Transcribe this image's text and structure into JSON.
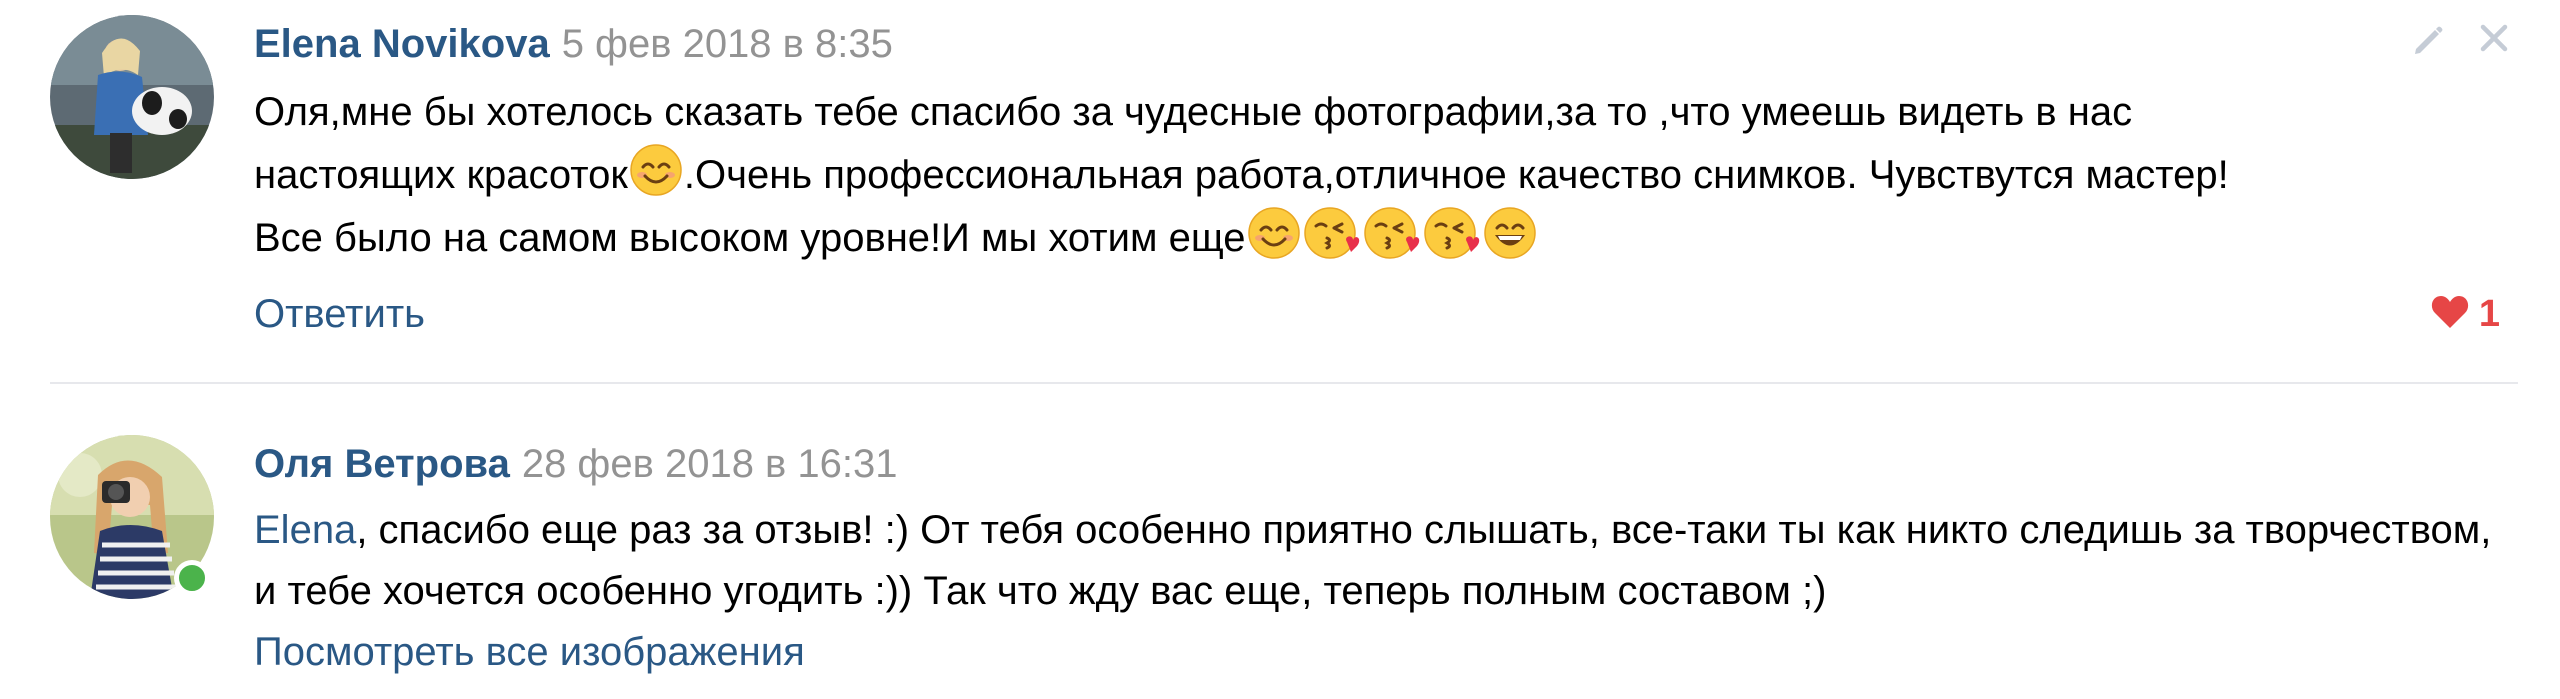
{
  "comments": [
    {
      "author": "Elena Novikova",
      "date": "5 фев 2018 в 8:35",
      "text_line_1": "Оля,мне бы хотелось сказать тебе спасибо за чудесные фотографии,за то ,что умеешь видеть в нас",
      "text_line_2a": "настоящих красоток",
      "text_line_2b": ".Очень профессиональная работа,отличное качество снимков. Чувствутся мастер!",
      "text_line_3": "Все было на самом высоком уровне!И мы хотим еще",
      "reply_label": "Ответить",
      "likes": "1",
      "emojis": [
        "smiling-face-emoji",
        "face-blowing-kiss-emoji",
        "grinning-face-emoji"
      ]
    },
    {
      "author": "Оля Ветрова",
      "date": "28 фев 2018 в 16:31",
      "mention": "Elena",
      "text_rest": ", спасибо еще раз за отзыв! :) От тебя особенно приятно слышать, все-таки ты как никто следишь за творчеством, и тебе хочется особенно угодить :)) Так что жду вас еще, теперь полным составом ;)",
      "view_all_images_label": "Посмотреть все изображения",
      "online": true
    }
  ],
  "icons": {
    "edit": "pencil-icon",
    "delete": "close-icon",
    "like": "heart-icon"
  },
  "colors": {
    "link": "#2a5885",
    "date": "#939393",
    "like": "#e64646",
    "online": "#4bb34b",
    "divider": "#e7e8ec",
    "icon_gray": "#c5ccd6"
  }
}
